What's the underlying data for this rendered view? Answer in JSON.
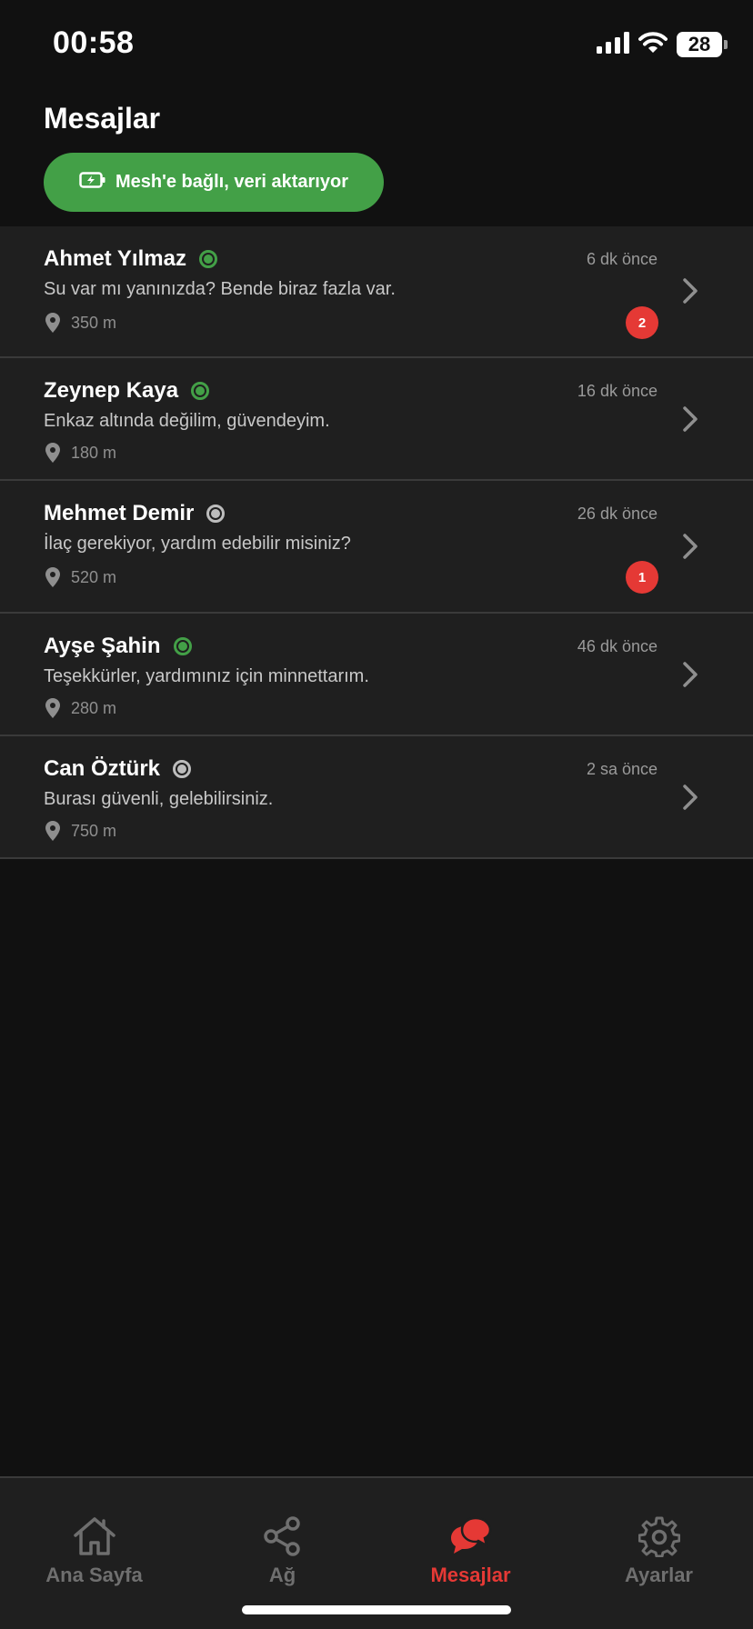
{
  "status_bar": {
    "time": "00:58",
    "battery": "28"
  },
  "header": {
    "title": "Mesajlar"
  },
  "mesh_status": {
    "label": "Mesh'e bağlı, veri aktarıyor",
    "color": "#43a047"
  },
  "chats": [
    {
      "name": "Ahmet Yılmaz",
      "online": true,
      "time": "6 dk önce",
      "message": "Su var mı yanınızda? Bende biraz fazla var.",
      "distance": "350 m",
      "unread": "2"
    },
    {
      "name": "Zeynep Kaya",
      "online": true,
      "time": "16 dk önce",
      "message": "Enkaz altında değilim, güvendeyim.",
      "distance": "180 m",
      "unread": ""
    },
    {
      "name": "Mehmet Demir",
      "online": false,
      "time": "26 dk önce",
      "message": "İlaç gerekiyor, yardım edebilir misiniz?",
      "distance": "520 m",
      "unread": "1"
    },
    {
      "name": "Ayşe Şahin",
      "online": true,
      "time": "46 dk önce",
      "message": "Teşekkürler, yardımınız için minnettarım.",
      "distance": "280 m",
      "unread": ""
    },
    {
      "name": "Can Öztürk",
      "online": false,
      "time": "2 sa önce",
      "message": "Burası güvenli, gelebilirsiniz.",
      "distance": "750 m",
      "unread": ""
    }
  ],
  "tabs": [
    {
      "label": "Ana Sayfa",
      "icon": "home-icon",
      "active": false
    },
    {
      "label": "Ağ",
      "icon": "share-network-icon",
      "active": false
    },
    {
      "label": "Mesajlar",
      "icon": "chat-bubbles-icon",
      "active": true
    },
    {
      "label": "Ayarlar",
      "icon": "gear-icon",
      "active": false
    }
  ],
  "colors": {
    "accent": "#e53935",
    "online": "#43a047",
    "offline": "#bdbdbd",
    "background": "#111111",
    "row": "#1f1f1f"
  }
}
